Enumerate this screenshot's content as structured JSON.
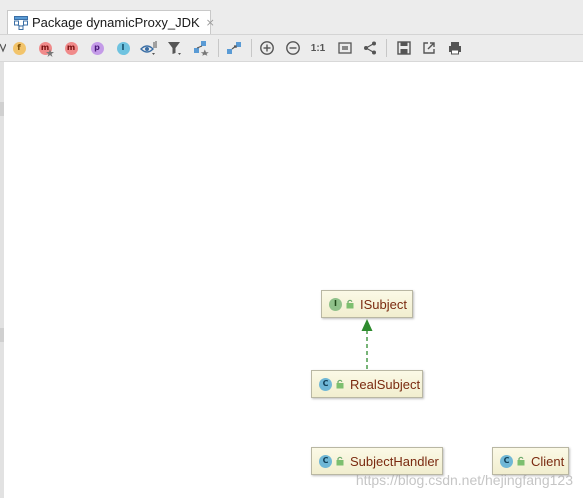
{
  "tab": {
    "title": "Package dynamicProxy_JDK",
    "close_glyph": "×",
    "icon": "uml-diagram-icon"
  },
  "toolbar": {
    "fields_letter": "f",
    "constructors_letter": "m",
    "methods_letter": "m",
    "properties_letter": "p",
    "inner_classes_letter": "I",
    "actual_size_label": "1:1"
  },
  "diagram": {
    "nodes": [
      {
        "label": "ISubject",
        "kind_letter": "I",
        "kind": "interface"
      },
      {
        "label": "RealSubject",
        "kind_letter": "C",
        "kind": "class"
      },
      {
        "label": "SubjectHandler",
        "kind_letter": "C",
        "kind": "class"
      },
      {
        "label": "Client",
        "kind_letter": "C",
        "kind": "class"
      }
    ],
    "edges": [
      {
        "from": "RealSubject",
        "to": "ISubject",
        "type": "implements"
      }
    ]
  },
  "watermark": "https://blog.csdn.net/hejingfang123",
  "colors": {
    "interface_badge": "#8fc18a",
    "class_badge": "#6fb7d6",
    "node_label": "#7a2a10",
    "edge": "#2e8b2e"
  }
}
